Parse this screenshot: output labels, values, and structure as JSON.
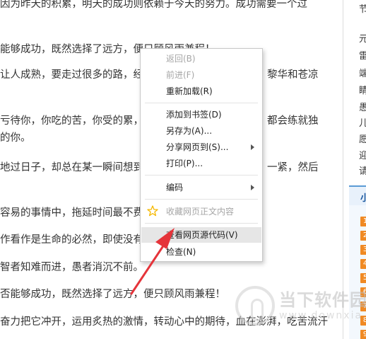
{
  "article": {
    "lines": [
      "因为昨天的积累，明天的成功则依赖于今天的努力。成功需要一个过",
      "能够成功，既然选择了远方，便只顾风雨兼程！",
      "让人成熟，要走过很多的路，经",
      "亏待你，你吃的苦，你受的累，",
      "地过日子，却总在某一瞬间想到",
      "容易的事情中，拖延时间最不费",
      "作看作是生命的必然，即使没有",
      "智者知难而进，愚者消沉不前。",
      "否能够成功，既然选择了远方，便只顾风雨兼程！",
      "奋力把它冲开，运用炙热的激情，转动心中的期待，血在澎湃，吃苦流汗"
    ],
    "tails": [
      "黎华和苍凉",
      "都会练就独",
      "的你。",
      "一紧，然后"
    ]
  },
  "sidebar": {
    "chars": [
      "节",
      "元",
      "雷",
      "端",
      "睛",
      "愚",
      "儿",
      "愿",
      "迎",
      "请"
    ],
    "rank_header": "小",
    "rank_badges": [
      "1",
      "2",
      "3",
      "4",
      "5",
      "6",
      "7",
      "8",
      "9"
    ]
  },
  "watermark": {
    "title": "当下软件园",
    "domain": "www.downxia.com"
  },
  "context_menu": {
    "items": {
      "back": "返回(B)",
      "forward": "前进(F)",
      "reload": "重新加载(R)",
      "bookmark": "添加到书签(D)",
      "save_as": "另存为(A)...",
      "share": "分享网页到(S)...",
      "print": "打印(P)...",
      "encoding": "编码",
      "favorite_text": "收藏网页正文内容",
      "view_source": "查看网页源代码(V)",
      "inspect": "检查(N)"
    }
  },
  "colors": {
    "accent": "#e5343a",
    "star": "#f5b800",
    "rank_badge": "#f08a24"
  }
}
